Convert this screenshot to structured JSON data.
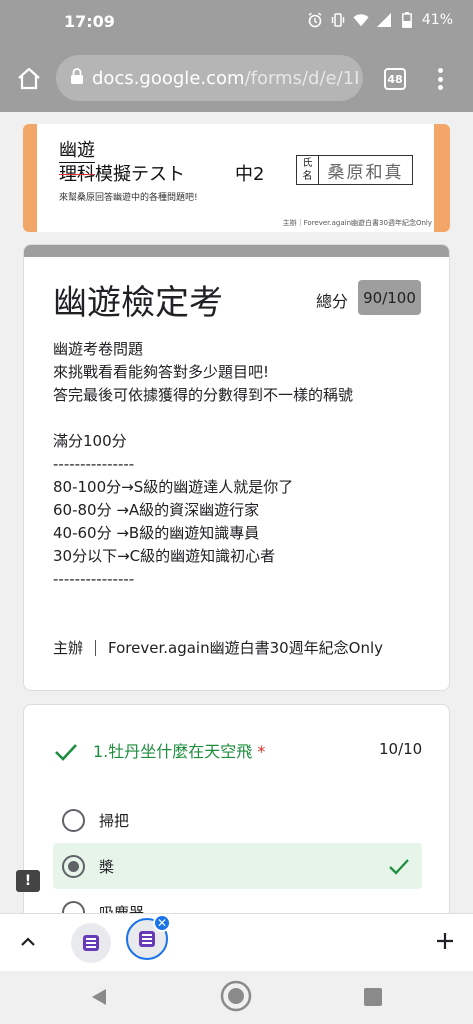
{
  "status": {
    "time": "17:09",
    "battery": "41%",
    "icons": [
      "alarm-icon",
      "vibrate-icon",
      "wifi-icon",
      "signal-icon",
      "battery-icon"
    ]
  },
  "browser": {
    "url_host": "docs.google.com",
    "url_path": "/forms/d/e/1I",
    "tab_count": "48"
  },
  "banner": {
    "title_line1": "幽遊",
    "title_strike": "理科",
    "title_rest": "模擬テスト",
    "grade": "中2",
    "name_label_1": "氏",
    "name_label_2": "名",
    "name_value": "桑原和真",
    "subtitle": "來幫桑原回答幽遊中的各種問題吧!",
    "footer": "主辦｜Forever.again幽遊白書30週年紀念Only"
  },
  "form": {
    "title": "幽遊檢定考",
    "score_label": "總分",
    "score": "90/100",
    "description": [
      "幽遊考卷問題",
      "來挑戰看看能夠答對多少題目吧!",
      "答完最後可依據獲得的分數得到不一樣的稱號",
      "",
      "滿分100分",
      "---------------",
      "80-100分→S級的幽遊達人就是你了",
      "60-80分  →A級的資深幽遊行家",
      "40-60分  →B級的幽遊知識專員",
      "30分以下→C級的幽遊知識初心者",
      "---------------"
    ],
    "organizer_label": "主辦",
    "organizer_value": "Forever.again幽遊白書30週年紀念Only"
  },
  "question1": {
    "title": "1.牡丹坐什麼在天空飛",
    "required_mark": "*",
    "points": "10/10",
    "options": [
      {
        "label": "掃把",
        "selected": false
      },
      {
        "label": "槳",
        "selected": true
      },
      {
        "label": "吸塵器",
        "selected": false
      }
    ]
  },
  "colors": {
    "chrome_gray": "#9e9e9e",
    "correct_green": "#1e8e3e",
    "correct_bg": "#e6f4ea",
    "accent_blue": "#1a73e8",
    "banner_orange": "#f2a668"
  }
}
